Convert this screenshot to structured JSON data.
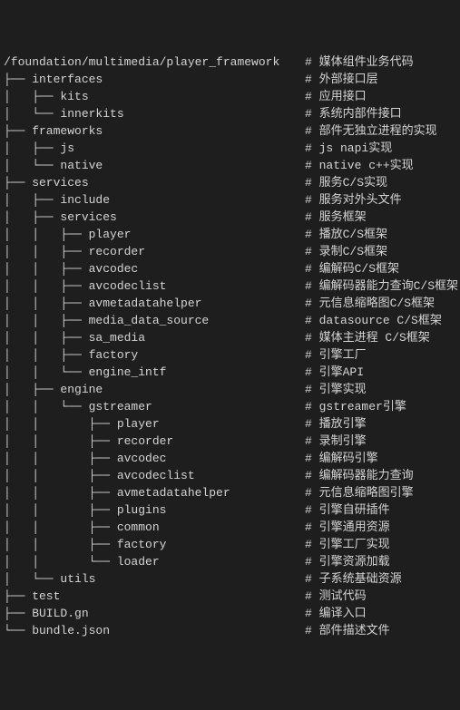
{
  "rows": [
    {
      "path": "/foundation/multimedia/player_framework",
      "comment": "# 媒体组件业务代码"
    },
    {
      "path": "├── interfaces",
      "comment": "# 外部接口层"
    },
    {
      "path": "│   ├── kits",
      "comment": "# 应用接口"
    },
    {
      "path": "│   └── innerkits",
      "comment": "# 系统内部件接口"
    },
    {
      "path": "├── frameworks",
      "comment": "# 部件无独立进程的实现"
    },
    {
      "path": "│   ├── js",
      "comment": "# js napi实现"
    },
    {
      "path": "│   └── native",
      "comment": "# native c++实现"
    },
    {
      "path": "├── services",
      "comment": "# 服务C/S实现"
    },
    {
      "path": "│   ├── include",
      "comment": "# 服务对外头文件"
    },
    {
      "path": "│   ├── services",
      "comment": "# 服务框架"
    },
    {
      "path": "│   │   ├── player",
      "comment": "# 播放C/S框架"
    },
    {
      "path": "│   │   ├── recorder",
      "comment": "# 录制C/S框架"
    },
    {
      "path": "│   │   ├── avcodec",
      "comment": "# 编解码C/S框架"
    },
    {
      "path": "│   │   ├── avcodeclist",
      "comment": "# 编解码器能力查询C/S框架"
    },
    {
      "path": "│   │   ├── avmetadatahelper",
      "comment": "# 元信息缩略图C/S框架"
    },
    {
      "path": "│   │   ├── media_data_source",
      "comment": "# datasource C/S框架"
    },
    {
      "path": "│   │   ├── sa_media",
      "comment": "# 媒体主进程 C/S框架"
    },
    {
      "path": "│   │   ├── factory",
      "comment": "# 引擎工厂"
    },
    {
      "path": "│   │   └── engine_intf",
      "comment": "# 引擎API"
    },
    {
      "path": "│   ├── engine",
      "comment": "# 引擎实现"
    },
    {
      "path": "│   │   └── gstreamer",
      "comment": "# gstreamer引擎"
    },
    {
      "path": "│   │       ├── player",
      "comment": "# 播放引擎"
    },
    {
      "path": "│   │       ├── recorder",
      "comment": "# 录制引擎"
    },
    {
      "path": "│   │       ├── avcodec",
      "comment": "# 编解码引擎"
    },
    {
      "path": "│   │       ├── avcodeclist",
      "comment": "# 编解码器能力查询"
    },
    {
      "path": "│   │       ├── avmetadatahelper",
      "comment": "# 元信息缩略图引擎"
    },
    {
      "path": "│   │       ├── plugins",
      "comment": "# 引擎自研插件"
    },
    {
      "path": "│   │       ├── common",
      "comment": "# 引擎通用资源"
    },
    {
      "path": "│   │       ├── factory",
      "comment": "# 引擎工厂实现"
    },
    {
      "path": "│   │       └── loader",
      "comment": "# 引擎资源加载"
    },
    {
      "path": "│   └── utils",
      "comment": "# 子系统基础资源"
    },
    {
      "path": "├── test",
      "comment": "# 测试代码"
    },
    {
      "path": "├── BUILD.gn",
      "comment": "# 编译入口"
    },
    {
      "path": "└── bundle.json",
      "comment": "# 部件描述文件"
    }
  ]
}
